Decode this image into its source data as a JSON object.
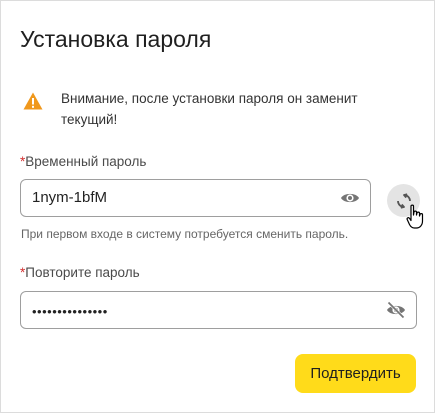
{
  "dialog": {
    "title": "Установка пароля",
    "warning": {
      "icon": "warning-icon",
      "text": "Внимание, после установки пароля он заменит текущий!"
    },
    "temp_password": {
      "required_mark": "*",
      "label": "Временный пароль",
      "value": "1nym-1bfM",
      "visibility_icon": "eye-icon",
      "regenerate_icon": "refresh-icon",
      "hint": "При первом входе в систему потребуется сменить пароль."
    },
    "repeat_password": {
      "required_mark": "*",
      "label": "Повторите пароль",
      "masked_value": "•••••••••••••••",
      "visibility_icon": "eye-off-icon"
    },
    "confirm_label": "Подтвердить"
  },
  "colors": {
    "accent_button": "#ffdb1a",
    "warning": "#f0981c",
    "required": "#d32f2f"
  }
}
